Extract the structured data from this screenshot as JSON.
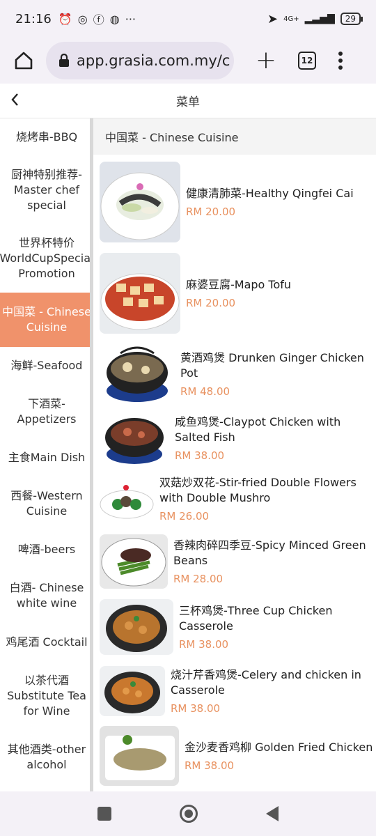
{
  "status": {
    "time": "21:16",
    "icons": [
      "alarm-icon",
      "instagram-icon",
      "facebook-icon",
      "wechat-icon",
      "more-icon"
    ],
    "network": "4G+",
    "battery": "29"
  },
  "browser": {
    "url": "app.grasia.com.my/c",
    "tab_count": "12"
  },
  "header": {
    "title": "菜单"
  },
  "sidebar": {
    "categories": [
      "烧烤串-BBQ",
      "厨神特别推荐-Master chef special",
      "世界杯特价 WorldCupSpecial Promotion",
      "中国菜 - Chinese Cuisine",
      "海鲜-Seafood",
      "下酒菜-Appetizers",
      "主食Main Dish",
      "西餐-Western Cuisine",
      "啤酒-beers",
      "白酒- Chinese white wine",
      "鸡尾酒 Cocktail",
      "以茶代酒 Substitute Tea for Wine",
      "其他酒类-other alcohol"
    ],
    "active_index": 3
  },
  "section": {
    "title": "中国菜 - Chinese Cuisine"
  },
  "items": [
    {
      "name": "健康清肺菜-Healthy Qingfei Cai",
      "price": "RM 20.00",
      "dish": "vegetables"
    },
    {
      "name": "麻婆豆腐-Mapo Tofu",
      "price": "RM 20.00",
      "dish": "tofu"
    },
    {
      "name": "黄酒鸡煲 Drunken Ginger Chicken Pot",
      "price": "RM 48.00",
      "dish": "claypot"
    },
    {
      "name": "咸鱼鸡煲-Claypot Chicken with Salted Fish",
      "price": "RM 38.00",
      "dish": "claypot"
    },
    {
      "name": "双菇炒双花-Stir-fried Double Flowers with Double Mushro",
      "price": "RM 26.00",
      "dish": "plate"
    },
    {
      "name": "香辣肉碎四季豆-Spicy Minced Green Beans",
      "price": "RM 28.00",
      "dish": "beans"
    },
    {
      "name": "三杯鸡煲-Three Cup Chicken Casserole",
      "price": "RM 38.00",
      "dish": "claypot"
    },
    {
      "name": "烧汁芹香鸡煲-Celery and chicken in Casserole",
      "price": "RM 38.00",
      "dish": "claypot"
    },
    {
      "name": "金沙麦香鸡柳 Golden Fried Chicken",
      "price": "RM 38.00",
      "dish": "platter"
    }
  ]
}
